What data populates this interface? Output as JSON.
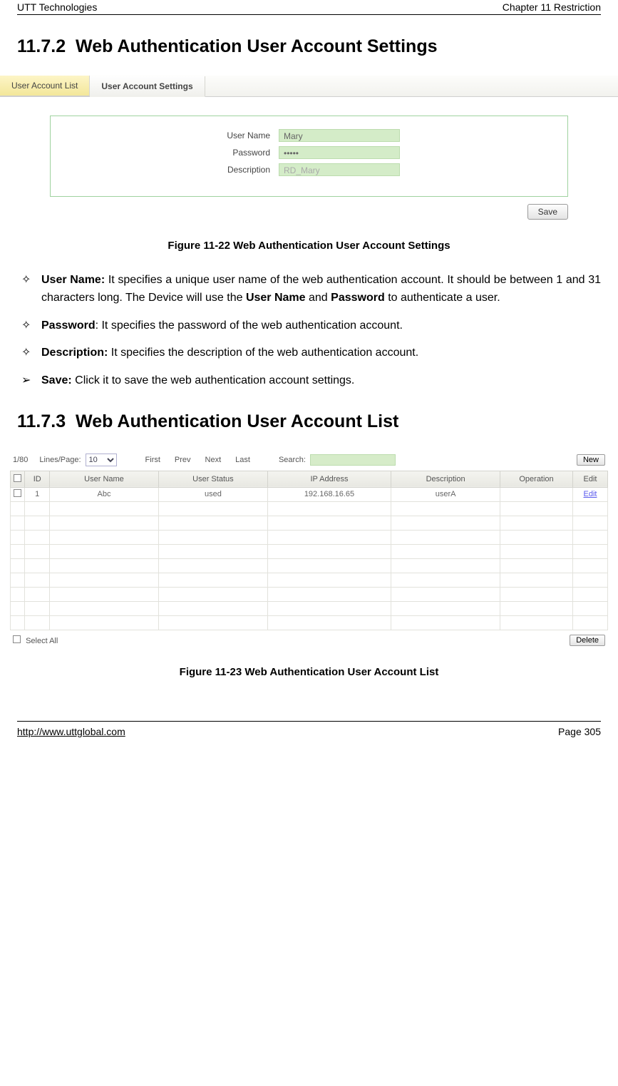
{
  "header": {
    "left": "UTT Technologies",
    "right": "Chapter 11 Restriction"
  },
  "footer": {
    "link": "http://www.uttglobal.com",
    "page": "Page 305"
  },
  "section1": {
    "num": "11.7.2",
    "title": "Web Authentication User Account Settings"
  },
  "fig1": {
    "tab_inactive": "User Account List",
    "tab_active": "User Account Settings",
    "row_user_label": "User Name",
    "row_user_value": "Mary",
    "row_pass_label": "Password",
    "row_pass_value": "•••••",
    "row_desc_label": "Description",
    "row_desc_value": "RD_Mary",
    "save": "Save",
    "caption": "Figure 11-22 Web Authentication User Account Settings"
  },
  "bullets": {
    "b1_label": "User Name:",
    "b1_text": " It specifies a unique user name of the web authentication account. It should be between 1 and 31 characters long. The Device will use the ",
    "b1_bold2": "User Name",
    "b1_text2": " and ",
    "b1_bold3": "Password",
    "b1_text3": " to authenticate a user.",
    "b2_label": "Password",
    "b2_text": ": It specifies the password of the web authentication account.",
    "b3_label": "Description:",
    "b3_text": " It specifies the description of the web authentication account.",
    "b4_label": "Save:",
    "b4_text": " Click it to save the web authentication account settings."
  },
  "section2": {
    "num": "11.7.3",
    "title": "Web Authentication User Account List"
  },
  "fig2": {
    "pager_count": "1/80",
    "lpp_label": "Lines/Page:",
    "lpp_value": "10",
    "first": "First",
    "prev": "Prev",
    "next": "Next",
    "last": "Last",
    "search_label": "Search:",
    "new_btn": "New",
    "th_id": "ID",
    "th_user": "User Name",
    "th_status": "User Status",
    "th_ip": "IP Address",
    "th_desc": "Description",
    "th_op": "Operation",
    "th_edit": "Edit",
    "row1": {
      "id": "1",
      "user": "Abc",
      "status": "used",
      "ip": "192.168.16.65",
      "desc": "userA",
      "op": "",
      "edit": "Edit"
    },
    "select_all": "Select All",
    "delete_btn": "Delete",
    "caption": "Figure 11-23 Web Authentication User Account List"
  }
}
